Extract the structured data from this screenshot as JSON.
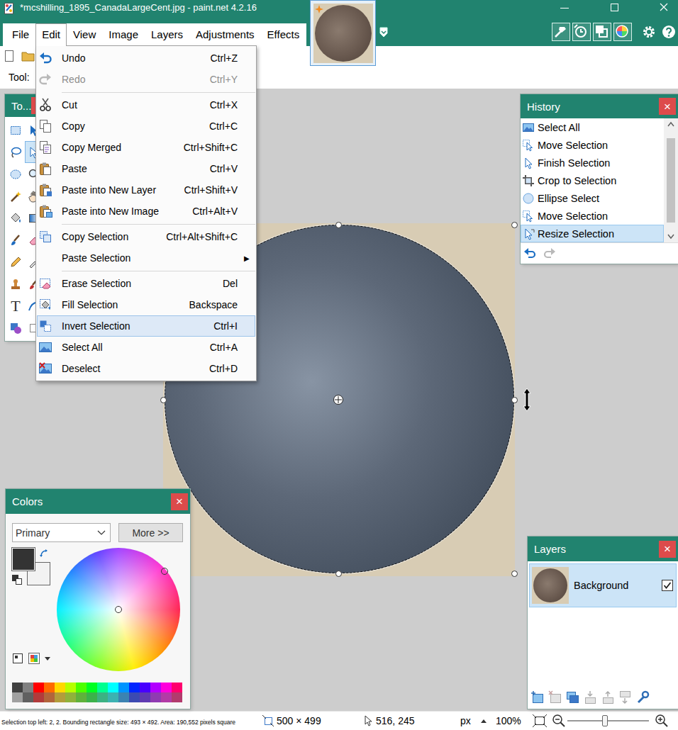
{
  "window": {
    "title": "*mcshilling_1895_CanadaLargeCent.jpg - paint.net 4.2.16"
  },
  "menu_bar": [
    {
      "label": "File",
      "selected": false
    },
    {
      "label": "Edit",
      "selected": true
    },
    {
      "label": "View",
      "selected": false
    },
    {
      "label": "Image",
      "selected": false
    },
    {
      "label": "Layers",
      "selected": false
    },
    {
      "label": "Adjustments",
      "selected": false
    },
    {
      "label": "Effects",
      "selected": false
    }
  ],
  "panel_toggles": [
    {
      "on": true
    },
    {
      "on": true
    },
    {
      "on": true
    },
    {
      "on": true
    }
  ],
  "toolbar": {
    "tool_label": "Tool:"
  },
  "tools_panel": {
    "title": "To...",
    "tools": [
      {
        "selected": false
      },
      {
        "selected": false
      },
      {
        "selected": false
      },
      {
        "selected": true
      },
      {
        "selected": false
      },
      {
        "selected": false
      },
      {
        "selected": false
      },
      {
        "selected": false
      },
      {
        "selected": false
      },
      {
        "selected": false
      },
      {
        "selected": false
      },
      {
        "selected": false
      },
      {
        "selected": false
      },
      {
        "selected": false
      },
      {
        "selected": false
      },
      {
        "selected": false
      },
      {
        "selected": false,
        "glyph": "T"
      },
      {
        "selected": false
      },
      {
        "selected": false
      },
      {
        "selected": false
      }
    ]
  },
  "edit_menu": {
    "groups": [
      [
        {
          "label": "Undo",
          "shortcut": "Ctrl+Z",
          "disabled": false,
          "selected": false
        },
        {
          "label": "Redo",
          "shortcut": "Ctrl+Y",
          "disabled": true,
          "selected": false
        }
      ],
      [
        {
          "label": "Cut",
          "shortcut": "Ctrl+X",
          "disabled": false,
          "selected": false
        },
        {
          "label": "Copy",
          "shortcut": "Ctrl+C",
          "disabled": false,
          "selected": false
        },
        {
          "label": "Copy Merged",
          "shortcut": "Ctrl+Shift+C",
          "disabled": false,
          "selected": false
        },
        {
          "label": "Paste",
          "shortcut": "Ctrl+V",
          "disabled": false,
          "selected": false
        },
        {
          "label": "Paste into New Layer",
          "shortcut": "Ctrl+Shift+V",
          "disabled": false,
          "selected": false
        },
        {
          "label": "Paste into New Image",
          "shortcut": "Ctrl+Alt+V",
          "disabled": false,
          "selected": false
        }
      ],
      [
        {
          "label": "Copy Selection",
          "shortcut": "Ctrl+Alt+Shift+C",
          "disabled": false,
          "selected": false
        },
        {
          "label": "Paste Selection",
          "shortcut": "",
          "arrow": "▶",
          "disabled": false,
          "selected": false
        }
      ],
      [
        {
          "label": "Erase Selection",
          "shortcut": "Del",
          "disabled": false,
          "selected": false
        },
        {
          "label": "Fill Selection",
          "shortcut": "Backspace",
          "disabled": false,
          "selected": false
        },
        {
          "label": "Invert Selection",
          "shortcut": "Ctrl+I",
          "disabled": false,
          "selected": true
        },
        {
          "label": "Select All",
          "shortcut": "Ctrl+A",
          "disabled": false,
          "selected": false
        },
        {
          "label": "Deselect",
          "shortcut": "Ctrl+D",
          "disabled": false,
          "selected": false
        }
      ]
    ]
  },
  "history": {
    "title": "History",
    "close": "×",
    "scrollbar": {
      "level": 0.85
    },
    "items": [
      {
        "label": "Select All",
        "selected": false
      },
      {
        "label": "Move Selection",
        "selected": false
      },
      {
        "label": "Finish Selection",
        "selected": false
      },
      {
        "label": "Crop to Selection",
        "selected": false
      },
      {
        "label": "Ellipse Select",
        "selected": false
      },
      {
        "label": "Move Selection",
        "selected": false
      },
      {
        "label": "Resize Selection",
        "selected": true
      }
    ]
  },
  "colors": {
    "title": "Colors",
    "close": "×",
    "mode": "Primary",
    "more_button": "More >>",
    "primary": "#333333",
    "secondary": "#f2f2f2",
    "wheel_marker": {
      "hue": 0.14,
      "saturation": 0.97
    },
    "palette": [
      {
        "color": "#404040"
      },
      {
        "color": "#808080"
      },
      {
        "color": "#ff0000"
      },
      {
        "color": "#ff6a00"
      },
      {
        "color": "#ffd800"
      },
      {
        "color": "#b6ff00"
      },
      {
        "color": "#4cff00"
      },
      {
        "color": "#00ff21"
      },
      {
        "color": "#00ff90"
      },
      {
        "color": "#00ffff"
      },
      {
        "color": "#0094ff"
      },
      {
        "color": "#0026ff"
      },
      {
        "color": "#4800ff"
      },
      {
        "color": "#b200ff"
      },
      {
        "color": "#ff00dc"
      },
      {
        "color": "#ff006e"
      },
      {
        "color": "#a0a0a0"
      },
      {
        "color": "#606060"
      },
      {
        "color": "#b23b3b"
      },
      {
        "color": "#b2653b"
      },
      {
        "color": "#b29d3b"
      },
      {
        "color": "#8fb23b"
      },
      {
        "color": "#5fb23b"
      },
      {
        "color": "#3bb24a"
      },
      {
        "color": "#3bb283"
      },
      {
        "color": "#3bb2b2"
      },
      {
        "color": "#3b83b2"
      },
      {
        "color": "#3b4ab2"
      },
      {
        "color": "#5f3bb2"
      },
      {
        "color": "#8f3bb2"
      },
      {
        "color": "#b23ba6"
      },
      {
        "color": "#b23b6d"
      }
    ]
  },
  "layers": {
    "title": "Layers",
    "close": "×",
    "items": [
      {
        "name": "Background",
        "visible": true,
        "selected": true
      }
    ]
  },
  "status_bar": {
    "selection_info": "Selection top left: 2, 2. Bounding rectangle size: 493 × 492. Area: 190,552 pixels square",
    "image_size": "500 × 499",
    "cursor_position": "516, 245",
    "unit": "px",
    "zoom": "100%",
    "zoom_slider": {
      "level": 0.46
    }
  }
}
